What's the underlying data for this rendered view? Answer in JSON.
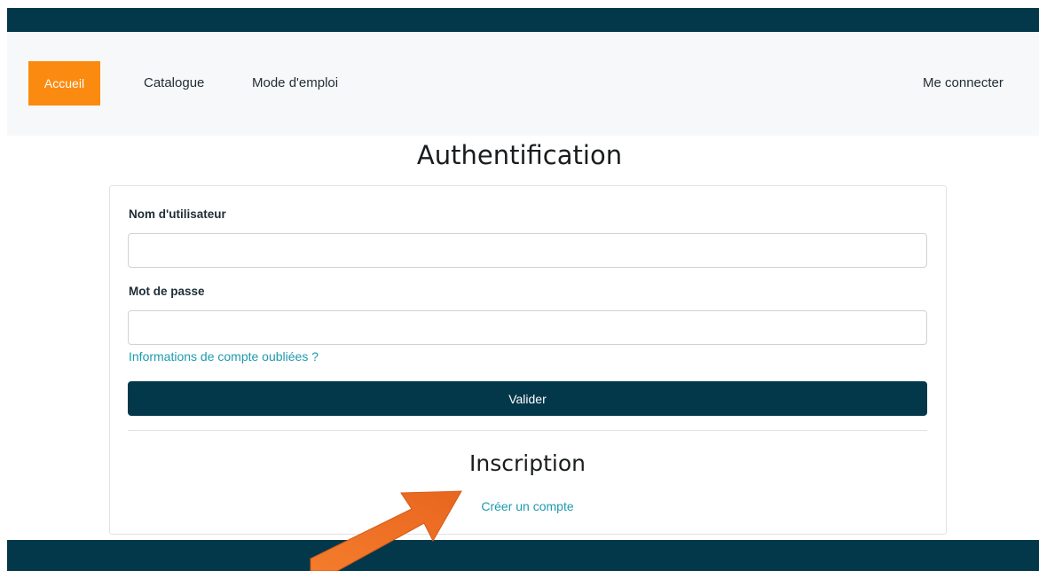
{
  "nav": {
    "items": [
      {
        "label": "Accueil",
        "active": true
      },
      {
        "label": "Catalogue",
        "active": false
      },
      {
        "label": "Mode d'emploi",
        "active": false
      }
    ],
    "login_label": "Me connecter"
  },
  "auth": {
    "title": "Authentification",
    "username_label": "Nom d'utilisateur",
    "username_value": "",
    "password_label": "Mot de passe",
    "password_value": "",
    "forgot_link": "Informations de compte oubliées ?",
    "submit_label": "Valider"
  },
  "signup": {
    "title": "Inscription",
    "create_link": "Créer un compte"
  },
  "colors": {
    "brand_dark": "#03384b",
    "accent_orange": "#fb8b10",
    "link": "#1d9ab0",
    "annotation_arrow": "#f47c2c"
  },
  "annotation": {
    "icon": "arrow-pointer-icon"
  }
}
